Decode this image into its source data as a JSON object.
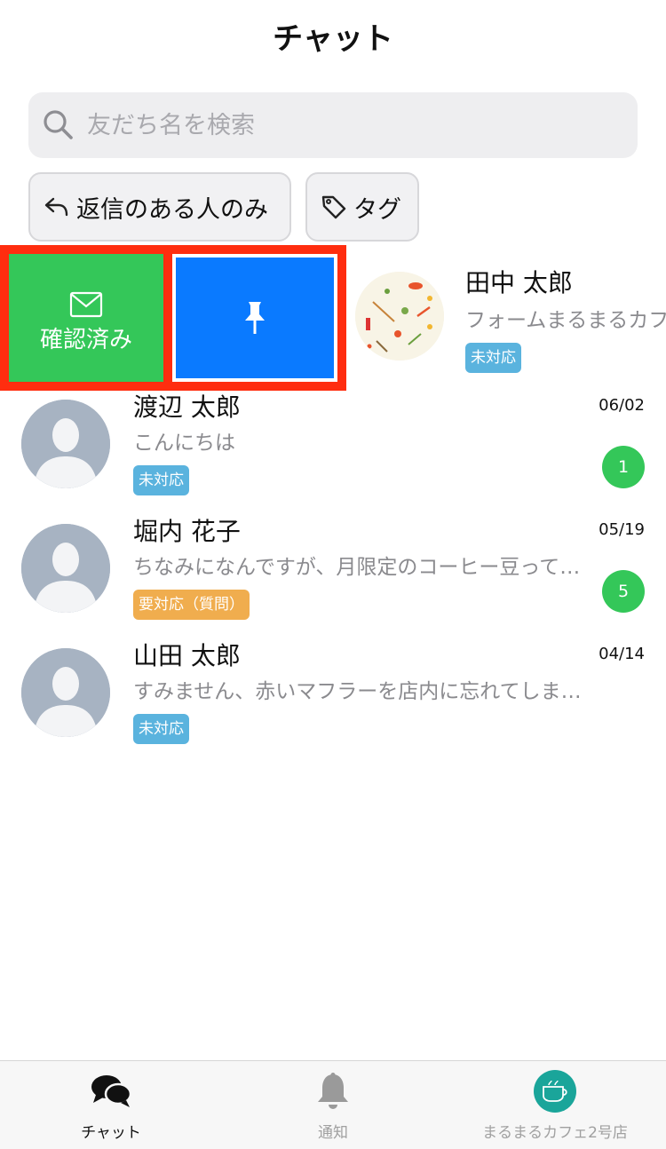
{
  "header": {
    "title": "チャット"
  },
  "search": {
    "placeholder": "友だち名を検索"
  },
  "filters": {
    "reply_only": "返信のある人のみ",
    "tag": "タグ"
  },
  "swipe_actions": {
    "confirm_label": "確認済み"
  },
  "colors": {
    "confirm_green": "#34c759",
    "pin_blue": "#0a7aff",
    "highlight_red": "#ff2d0f",
    "tag_blue": "#5ab3de",
    "tag_orange": "#f0ad4e",
    "badge_green": "#34c759"
  },
  "chats": [
    {
      "name": "田中 太郎",
      "message": "フォームまるまるカフェ",
      "tag": "未対応",
      "tag_color": "blue",
      "date": "",
      "unread": ""
    },
    {
      "name": "渡辺 太郎",
      "message": "こんにちは",
      "tag": "未対応",
      "tag_color": "blue",
      "date": "06/02",
      "unread": "1"
    },
    {
      "name": "堀内 花子",
      "message": "ちなみになんですが、月限定のコーヒー豆って…",
      "tag": "要対応（質問）",
      "tag_color": "orange",
      "date": "05/19",
      "unread": "5"
    },
    {
      "name": "山田 太郎",
      "message": "すみません、赤いマフラーを店内に忘れてしま…",
      "tag": "未対応",
      "tag_color": "blue",
      "date": "04/14",
      "unread": ""
    }
  ],
  "tabbar": {
    "chat": "チャット",
    "notify": "通知",
    "shop": "まるまるカフェ2号店"
  },
  "icons": {
    "search": "search-icon",
    "reply": "reply-icon",
    "tag": "tag-icon",
    "envelope": "envelope-icon",
    "pin": "pin-icon",
    "avatar": "default-avatar-icon",
    "chat": "chat-bubbles-icon",
    "bell": "bell-icon",
    "shop_logo": "shop-logo-icon"
  }
}
